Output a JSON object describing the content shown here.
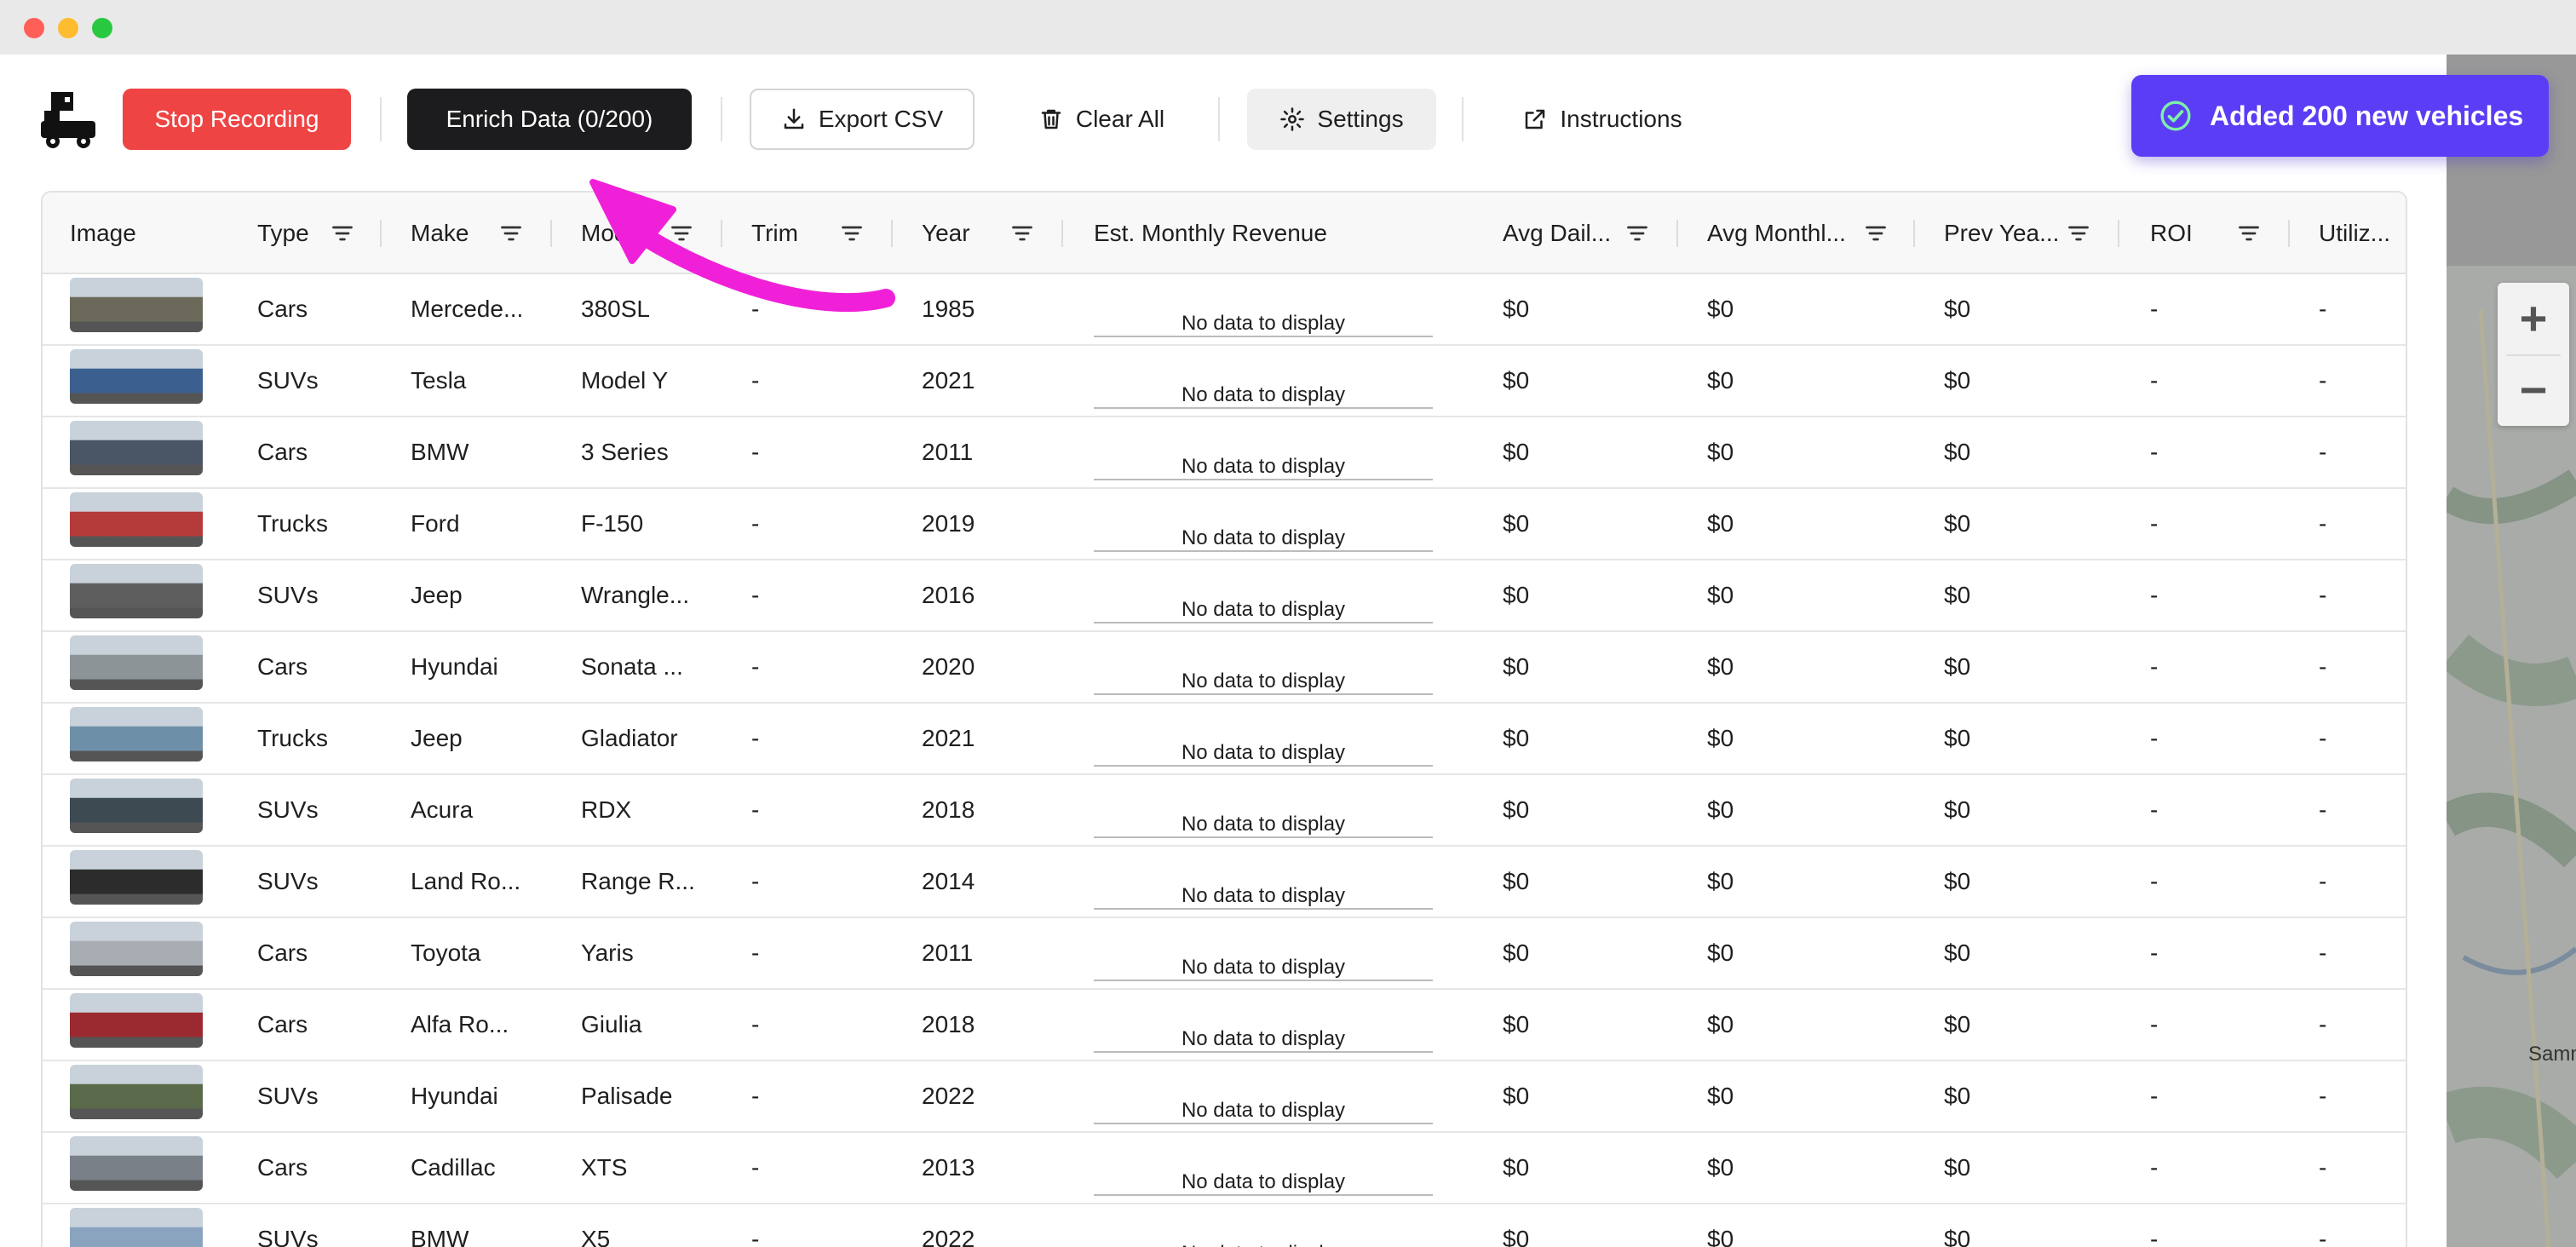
{
  "toolbar": {
    "stop_recording": "Stop Recording",
    "enrich_data": "Enrich Data (0/200)",
    "export_csv": "Export CSV",
    "clear_all": "Clear All",
    "settings": "Settings",
    "instructions": "Instructions"
  },
  "toast": {
    "message": "Added 200 new vehicles"
  },
  "table": {
    "columns": [
      "Image",
      "Type",
      "Make",
      "Model",
      "Trim",
      "Year",
      "Est. Monthly Revenue",
      "Avg Dail...",
      "Avg Monthl...",
      "Prev Yea...",
      "ROI",
      "Utiliz..."
    ],
    "no_data_text": "No data to display",
    "rows": [
      {
        "type": "Cars",
        "make": "Mercede...",
        "model": "380SL",
        "trim": "-",
        "year": "1985",
        "avg_daily": "$0",
        "avg_monthly": "$0",
        "prev_year": "$0",
        "roi": "-",
        "util": "-",
        "thumb": "#6b6a5a"
      },
      {
        "type": "SUVs",
        "make": "Tesla",
        "model": "Model Y",
        "trim": "-",
        "year": "2021",
        "avg_daily": "$0",
        "avg_monthly": "$0",
        "prev_year": "$0",
        "roi": "-",
        "util": "-",
        "thumb": "#3b5f8f"
      },
      {
        "type": "Cars",
        "make": "BMW",
        "model": "3 Series",
        "trim": "-",
        "year": "2011",
        "avg_daily": "$0",
        "avg_monthly": "$0",
        "prev_year": "$0",
        "roi": "-",
        "util": "-",
        "thumb": "#4a5566"
      },
      {
        "type": "Trucks",
        "make": "Ford",
        "model": "F-150",
        "trim": "-",
        "year": "2019",
        "avg_daily": "$0",
        "avg_monthly": "$0",
        "prev_year": "$0",
        "roi": "-",
        "util": "-",
        "thumb": "#b53a3a"
      },
      {
        "type": "SUVs",
        "make": "Jeep",
        "model": "Wrangle...",
        "trim": "-",
        "year": "2016",
        "avg_daily": "$0",
        "avg_monthly": "$0",
        "prev_year": "$0",
        "roi": "-",
        "util": "-",
        "thumb": "#5e5e5e"
      },
      {
        "type": "Cars",
        "make": "Hyundai",
        "model": "Sonata ...",
        "trim": "-",
        "year": "2020",
        "avg_daily": "$0",
        "avg_monthly": "$0",
        "prev_year": "$0",
        "roi": "-",
        "util": "-",
        "thumb": "#8d9498"
      },
      {
        "type": "Trucks",
        "make": "Jeep",
        "model": "Gladiator",
        "trim": "-",
        "year": "2021",
        "avg_daily": "$0",
        "avg_monthly": "$0",
        "prev_year": "$0",
        "roi": "-",
        "util": "-",
        "thumb": "#6e8fa8"
      },
      {
        "type": "SUVs",
        "make": "Acura",
        "model": "RDX",
        "trim": "-",
        "year": "2018",
        "avg_daily": "$0",
        "avg_monthly": "$0",
        "prev_year": "$0",
        "roi": "-",
        "util": "-",
        "thumb": "#3d4a52"
      },
      {
        "type": "SUVs",
        "make": "Land Ro...",
        "model": "Range R...",
        "trim": "-",
        "year": "2014",
        "avg_daily": "$0",
        "avg_monthly": "$0",
        "prev_year": "$0",
        "roi": "-",
        "util": "-",
        "thumb": "#2c2c2c"
      },
      {
        "type": "Cars",
        "make": "Toyota",
        "model": "Yaris",
        "trim": "-",
        "year": "2011",
        "avg_daily": "$0",
        "avg_monthly": "$0",
        "prev_year": "$0",
        "roi": "-",
        "util": "-",
        "thumb": "#a7adb2"
      },
      {
        "type": "Cars",
        "make": "Alfa Ro...",
        "model": "Giulia",
        "trim": "-",
        "year": "2018",
        "avg_daily": "$0",
        "avg_monthly": "$0",
        "prev_year": "$0",
        "roi": "-",
        "util": "-",
        "thumb": "#9b2a30"
      },
      {
        "type": "SUVs",
        "make": "Hyundai",
        "model": "Palisade",
        "trim": "-",
        "year": "2022",
        "avg_daily": "$0",
        "avg_monthly": "$0",
        "prev_year": "$0",
        "roi": "-",
        "util": "-",
        "thumb": "#5a6a4a"
      },
      {
        "type": "Cars",
        "make": "Cadillac",
        "model": "XTS",
        "trim": "-",
        "year": "2013",
        "avg_daily": "$0",
        "avg_monthly": "$0",
        "prev_year": "$0",
        "roi": "-",
        "util": "-",
        "thumb": "#7a8088"
      },
      {
        "type": "SUVs",
        "make": "BMW",
        "model": "X5",
        "trim": "-",
        "year": "2022",
        "avg_daily": "$0",
        "avg_monthly": "$0",
        "prev_year": "$0",
        "roi": "-",
        "util": "-",
        "thumb": "#8aa4c0"
      }
    ]
  },
  "map": {
    "zoom_in": "+",
    "zoom_out": "−",
    "label": "Samm"
  },
  "colors": {
    "stop": "#ef4444",
    "enrich": "#1c1c1e",
    "toast": "#5b3df5",
    "annotation_arrow": "#f020d8"
  },
  "icons": [
    "logo-icon",
    "download-icon",
    "trash-icon",
    "gear-icon",
    "external-link-icon",
    "check-circle-icon",
    "filter-icon"
  ]
}
